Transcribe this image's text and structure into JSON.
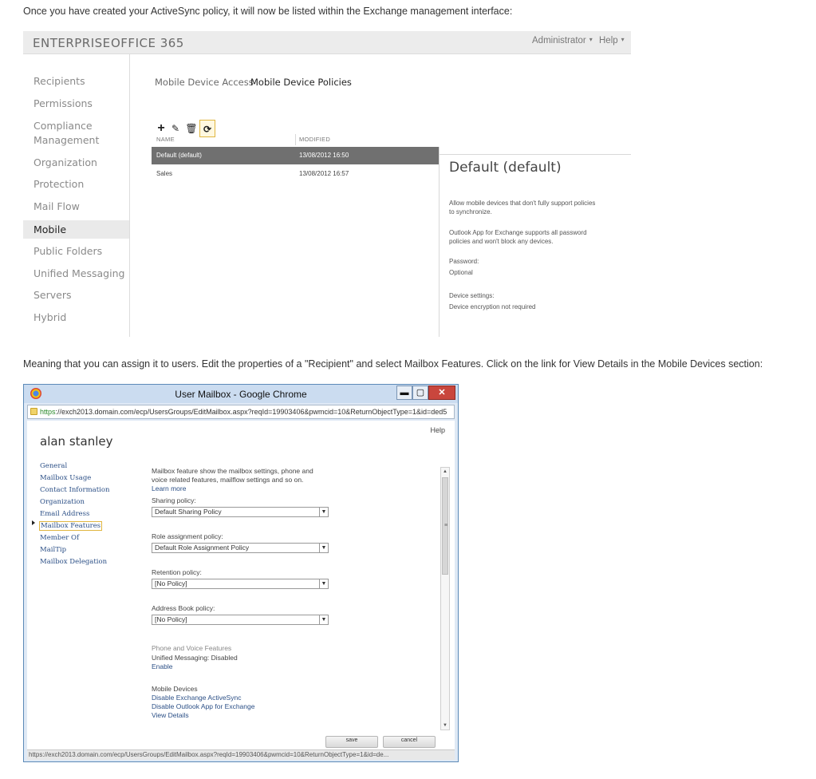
{
  "text": {
    "para1": "Once you have created your ActiveSync policy, it will now be listed within the Exchange management interface:",
    "para2": "Meaning that you can assign it to users. Edit the properties of a \"Recipient\" and select Mailbox Features. Click on the link for View Details in the Mobile Devices section:"
  },
  "eac": {
    "header": {
      "enterprise": "ENTERPRISE",
      "office365": "OFFICE 365",
      "admin": "Administrator",
      "help": "Help",
      "caret": "▾"
    },
    "nav": [
      "Recipients",
      "Permissions",
      "Compliance",
      "Management",
      "Organization",
      "Protection",
      "Mail Flow",
      "Mobile",
      "Public Folders",
      "Unified Messaging",
      "Servers",
      "Hybrid"
    ],
    "subtabs": {
      "access": "Mobile Device Access",
      "policies": "Mobile Device Policies"
    },
    "toolbar": {
      "add": "+",
      "edit": "✎",
      "delete": "🗑",
      "refresh": "⟳"
    },
    "columns": {
      "name": "NAME",
      "modified": "MODIFIED"
    },
    "rows": [
      {
        "name": "Default (default)",
        "modified": "13/08/2012 16:50"
      },
      {
        "name": "Sales",
        "modified": "13/08/2012 16:57"
      }
    ],
    "detail": {
      "title": "Default (default)",
      "line1": "Allow mobile devices that don't fully support policies",
      "line2": "to synchronize.",
      "line3": "Outlook App for Exchange supports all password",
      "line4": "policies and won't block any devices.",
      "password_label": "Password:",
      "password_value": "Optional",
      "settings_label": "Device settings:",
      "settings_value": "Device encryption not required"
    }
  },
  "chrome": {
    "title": "User Mailbox - Google Chrome",
    "buttons": {
      "minimize": "▬",
      "maximize": "▢",
      "close": "✕"
    },
    "address_https": "https",
    "address_rest": "://exch2013.domain.com/ecp/UsersGroups/EditMailbox.aspx?reqId=19903406&pwmcid=10&ReturnObjectType=1&id=ded5",
    "help": "Help",
    "user_name": "alan stanley",
    "side_links": [
      "General",
      "Mailbox Usage",
      "Contact Information",
      "Organization",
      "Email Address",
      "Mailbox Features",
      "Member Of",
      "MailTip",
      "Mailbox Delegation"
    ],
    "form": {
      "intro1": "Mailbox feature show the mailbox settings, phone and",
      "intro2": "voice related features, mailflow settings and so on.",
      "learn_more": "Learn more",
      "sharing_label": "Sharing policy:",
      "sharing_value": "Default Sharing Policy",
      "role_label": "Role assignment policy:",
      "role_value": "Default Role Assignment Policy",
      "retention_label": "Retention policy:",
      "retention_value": "[No Policy]",
      "addressbook_label": "Address Book policy:",
      "addressbook_value": "[No Policy]",
      "phone_heading": "Phone and Voice Features",
      "um_status": "Unified Messaging: Disabled",
      "enable": "Enable",
      "mobile_heading": "Mobile Devices",
      "disable_eas": "Disable Exchange ActiveSync",
      "disable_owa": "Disable Outlook App for Exchange",
      "view_details": "View Details",
      "dropdown_arrow": "▼"
    },
    "scroll": {
      "up": "▲",
      "down": "▼",
      "grip": "≡"
    },
    "save": "save",
    "cancel": "cancel",
    "status": "https://exch2013.domain.com/ecp/UsersGroups/EditMailbox.aspx?reqId=19903406&pwmcid=10&ReturnObjectType=1&id=de..."
  }
}
